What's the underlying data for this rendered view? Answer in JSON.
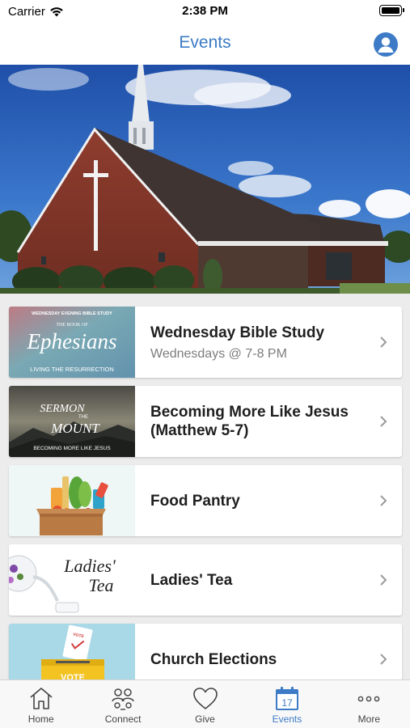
{
  "status_bar": {
    "carrier": "Carrier",
    "time": "2:38 PM"
  },
  "nav": {
    "title": "Events"
  },
  "colors": {
    "accent": "#3d7bc6",
    "card_bg": "#ffffff",
    "list_bg": "#ececec"
  },
  "events": [
    {
      "title": "Wednesday Bible Study",
      "subtitle": "Wednesdays @ 7-8 PM",
      "thumb_icon": "ephesians-thumbnail",
      "thumb_text": {
        "top": "WEDNESDAY EVENING BIBLE STUDY",
        "mid": "THE BOOK OF",
        "main": "Ephesians",
        "bottom": "LIVING THE RESURRECTION"
      }
    },
    {
      "title": "Becoming More Like Jesus (Matthew 5-7)",
      "subtitle": "",
      "thumb_icon": "sermon-on-the-mount-thumbnail",
      "thumb_text": {
        "line1": "SERMON",
        "line2": "THE",
        "line3": "MOUNT",
        "bottom": "BECOMING MORE LIKE JESUS"
      }
    },
    {
      "title": "Food Pantry",
      "subtitle": "",
      "thumb_icon": "food-box-thumbnail"
    },
    {
      "title": "Ladies' Tea",
      "subtitle": "",
      "thumb_icon": "teapot-thumbnail",
      "thumb_text": {
        "line1": "Ladies'",
        "line2": "Tea"
      }
    },
    {
      "title": "Church Elections",
      "subtitle": "",
      "thumb_icon": "ballot-box-thumbnail",
      "thumb_text": {
        "ballot": "VOTE",
        "box": "VOTE"
      }
    }
  ],
  "tabs": [
    {
      "label": "Home",
      "icon": "home-icon",
      "active": false
    },
    {
      "label": "Connect",
      "icon": "connect-icon",
      "active": false
    },
    {
      "label": "Give",
      "icon": "heart-icon",
      "active": false
    },
    {
      "label": "Events",
      "icon": "calendar-icon",
      "active": true,
      "badge": "17"
    },
    {
      "label": "More",
      "icon": "more-icon",
      "active": false
    }
  ]
}
